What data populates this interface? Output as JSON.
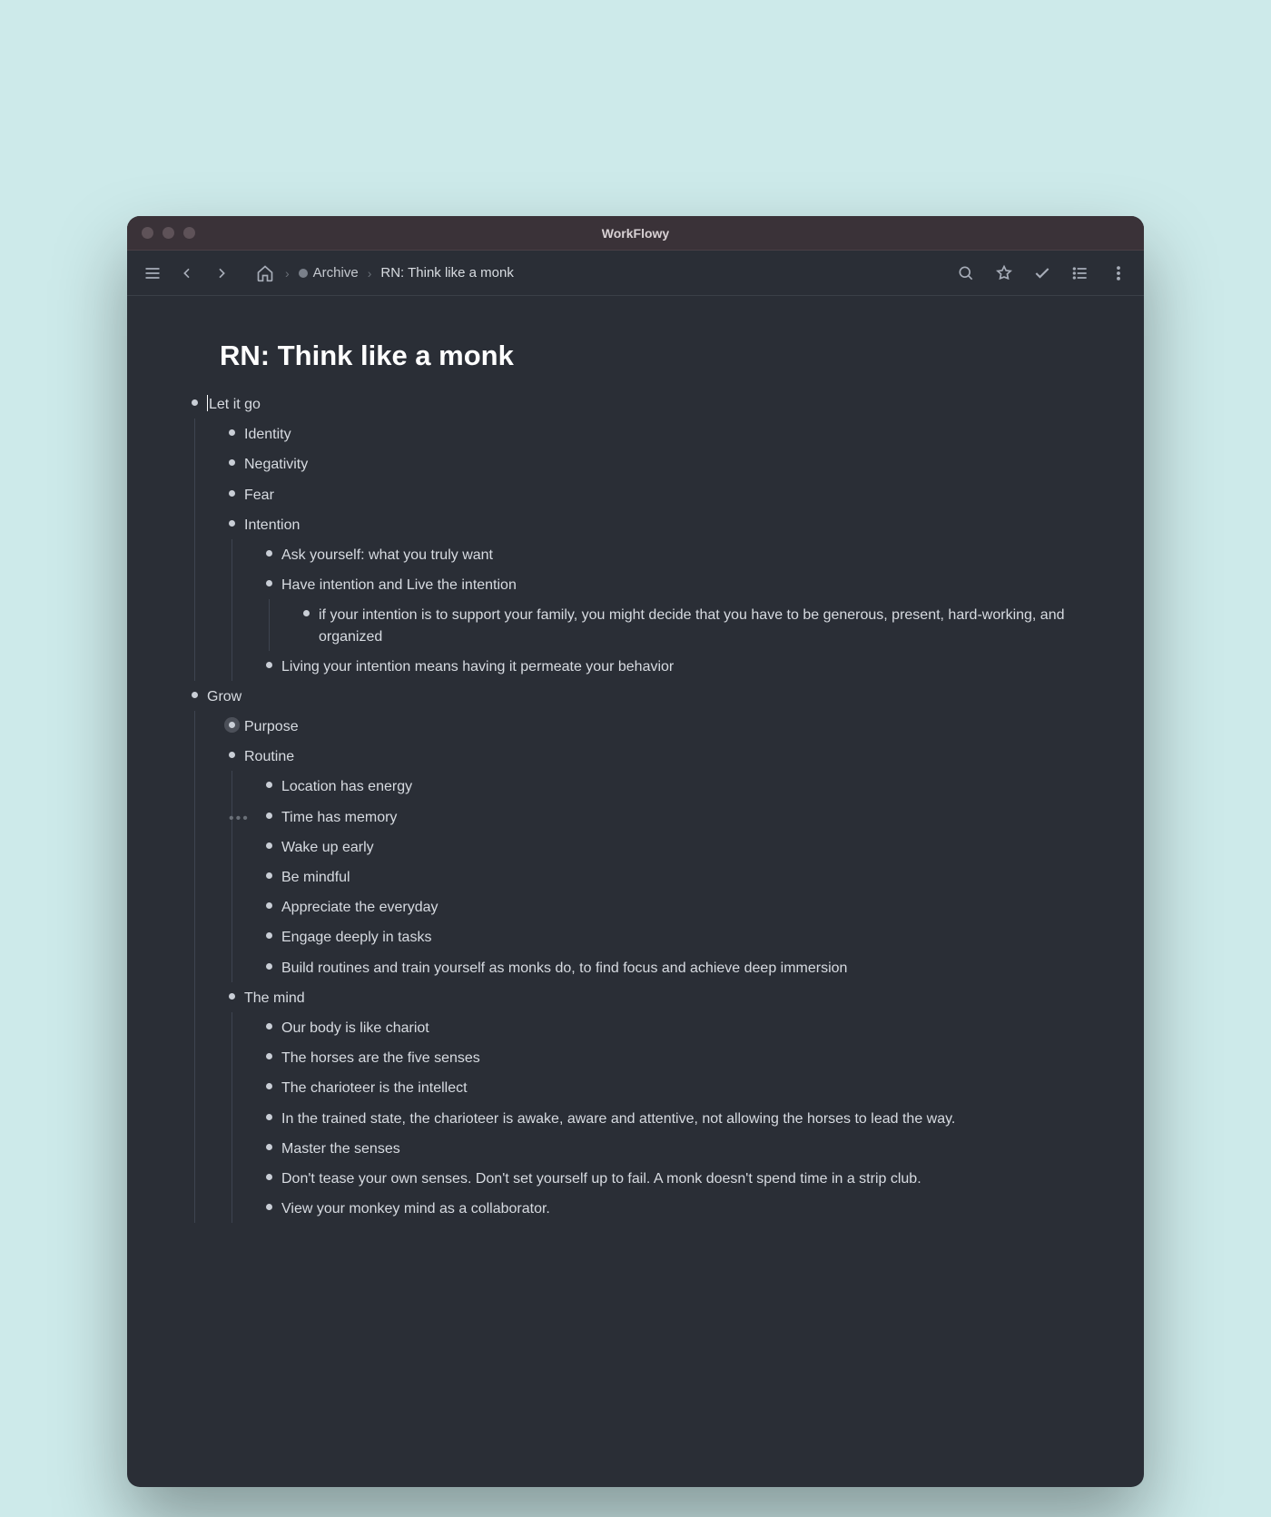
{
  "window": {
    "title": "WorkFlowy"
  },
  "breadcrumbs": {
    "archive": "Archive",
    "current": "RN: Think like a monk"
  },
  "page": {
    "title": "RN: Think like a monk"
  },
  "outline": [
    {
      "text": "Let it go",
      "cursor": true,
      "children": [
        {
          "text": "Identity"
        },
        {
          "text": "Negativity"
        },
        {
          "text": "Fear"
        },
        {
          "text": "Intention",
          "children": [
            {
              "text": "Ask yourself: what you truly want"
            },
            {
              "text": "Have intention and Live the intention",
              "children": [
                {
                  "text": "if your intention is to support your family, you might decide that you have to be generous, present, hard-working, and organized"
                }
              ]
            },
            {
              "text": "Living your intention means having it permeate your behavior"
            }
          ]
        }
      ]
    },
    {
      "text": "Grow",
      "children": [
        {
          "text": "Purpose",
          "collapsed": true
        },
        {
          "text": "Routine",
          "children": [
            {
              "text": "Location has energy"
            },
            {
              "text": "Time has memory",
              "hovered": true
            },
            {
              "text": "Wake up early"
            },
            {
              "text": "Be mindful"
            },
            {
              "text": "Appreciate the everyday"
            },
            {
              "text": "Engage deeply in tasks"
            },
            {
              "text": "Build routines and train yourself as monks do, to find focus and achieve deep immersion"
            }
          ]
        },
        {
          "text": "The mind",
          "children": [
            {
              "text": "Our body is like chariot"
            },
            {
              "text": "The horses are the five senses"
            },
            {
              "text": "The charioteer is the intellect"
            },
            {
              "text": "In the trained state, the charioteer is awake, aware and attentive, not allowing the horses to lead the way."
            },
            {
              "text": " Master the senses"
            },
            {
              "text": "Don't tease your own senses. Don't set yourself up to fail. A monk doesn't spend time in a strip club."
            },
            {
              "text": "View your monkey mind as a collaborator."
            }
          ]
        }
      ]
    }
  ]
}
